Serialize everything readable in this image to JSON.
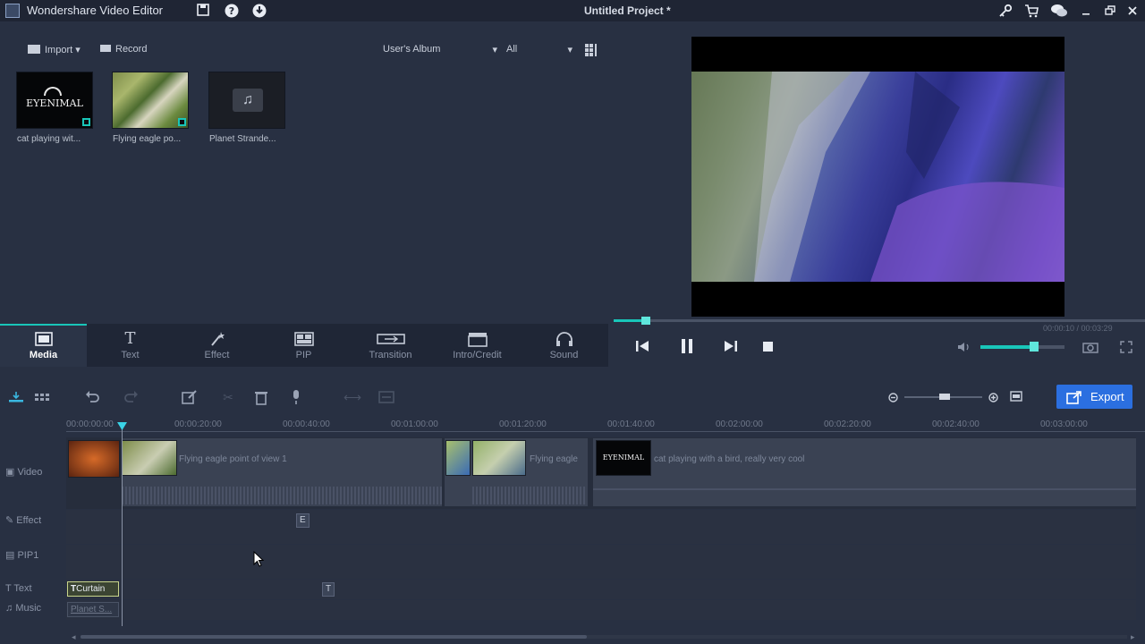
{
  "app": {
    "title": "Wondershare Video Editor",
    "project_title": "Untitled Project *"
  },
  "media_toolbar": {
    "import_label": "Import",
    "record_label": "Record",
    "album_select": "User's Album",
    "filter_select": "All"
  },
  "media_items": [
    {
      "label": "cat playing wit...",
      "logo_text": "EYENIMAL"
    },
    {
      "label": "Flying eagle po..."
    },
    {
      "label": "Planet Strande..."
    }
  ],
  "tabs": [
    {
      "label": "Media",
      "icon": "media-icon"
    },
    {
      "label": "Text",
      "icon": "text-icon"
    },
    {
      "label": "Effect",
      "icon": "magic-wand-icon"
    },
    {
      "label": "PIP",
      "icon": "pip-icon"
    },
    {
      "label": "Transition",
      "icon": "transition-icon"
    },
    {
      "label": "Intro/Credit",
      "icon": "clapper-icon"
    },
    {
      "label": "Sound",
      "icon": "headphones-icon"
    }
  ],
  "player": {
    "time": "00:00:10 / 00:03:29",
    "seek_progress": 0.07,
    "volume_level": 0.6
  },
  "export_label": "Export",
  "ruler_ticks": [
    "00:00:00:00",
    "00:00:20:00",
    "00:00:40:00",
    "00:01:00:00",
    "00:01:20:00",
    "00:01:40:00",
    "00:02:00:00",
    "00:02:20:00",
    "00:02:40:00",
    "00:03:00:00"
  ],
  "tracks": {
    "video": {
      "label": "Video",
      "clips": [
        "Flying eagle point of view 1",
        "Flying eagle",
        "cat playing with a bird, really very cool"
      ],
      "logo_text": "EYENIMAL"
    },
    "effect": {
      "label": "Effect",
      "marker": "E"
    },
    "pip": {
      "label": "PIP1"
    },
    "text": {
      "label": "Text",
      "clip": "Curtain",
      "marker": "T"
    },
    "music": {
      "label": "Music",
      "clip": "Planet S..."
    }
  },
  "colors": {
    "accent": "#19c6b9",
    "export": "#2b6fe0",
    "background": "#283042"
  }
}
